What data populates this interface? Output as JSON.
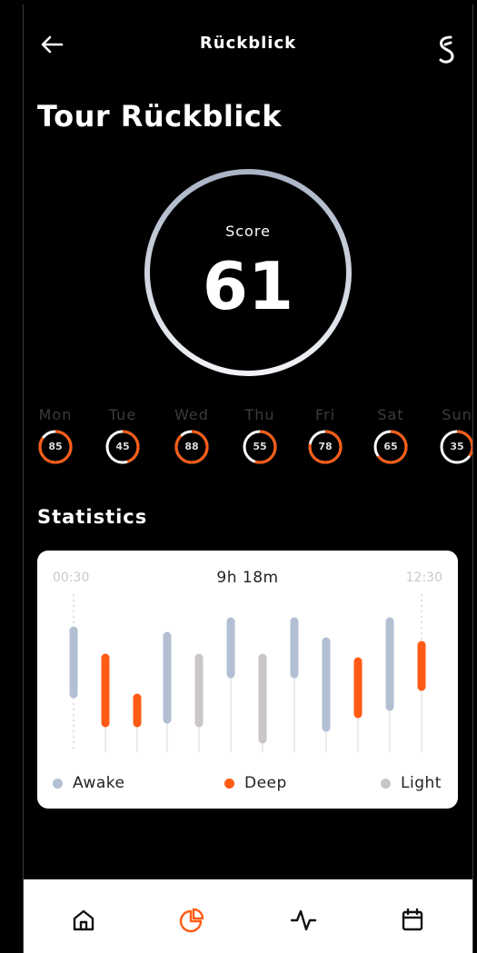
{
  "header": {
    "title": "Rückblick",
    "back_icon": "arrow-left-icon",
    "brand_icon": "brand-logo-icon"
  },
  "page_title": "Tour Rückblick",
  "score": {
    "label": "Score",
    "value": "61"
  },
  "days": [
    {
      "name": "Mon",
      "score": "85",
      "level": 0.85
    },
    {
      "name": "Tue",
      "score": "45",
      "level": 0.45
    },
    {
      "name": "Wed",
      "score": "88",
      "level": 0.88
    },
    {
      "name": "Thu",
      "score": "55",
      "level": 0.55
    },
    {
      "name": "Fri",
      "score": "78",
      "level": 0.78
    },
    {
      "name": "Sat",
      "score": "65",
      "level": 0.65
    },
    {
      "name": "Sun",
      "score": "35",
      "level": 0.35
    }
  ],
  "statistics": {
    "title": "Statistics",
    "start_time": "00:30",
    "end_time": "12:30",
    "total": "9h 18m",
    "legend": [
      {
        "label": "Awake",
        "color": "#b3bfd3"
      },
      {
        "label": "Deep",
        "color": "#ff5b14"
      },
      {
        "label": "Light",
        "color": "#cbc6c6"
      }
    ]
  },
  "nav": [
    {
      "name": "home-icon",
      "active": false
    },
    {
      "name": "pie-chart-icon",
      "active": true
    },
    {
      "name": "activity-icon",
      "active": false
    },
    {
      "name": "calendar-icon",
      "active": false
    }
  ],
  "colors": {
    "accent": "#ff5b14",
    "ring": "#b8c2d2",
    "awake": "#b3bfd3",
    "deep": "#ff5b14",
    "light": "#cbc6c6"
  }
}
